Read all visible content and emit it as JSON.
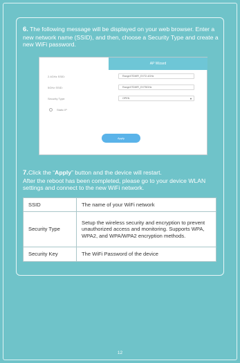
{
  "step6": {
    "number": "6.",
    "text": "The following message will be displayed on your web browser. Enter a new network name (SSID), and then, choose a Security Type and create a new WiFi password."
  },
  "wizard": {
    "title": "AP Wizard",
    "ssid24_label": "2.4GHz SSID:",
    "ssid24_value": "RangeXTDWFi_EXT2.4GHz",
    "ssid5_label": "5GHz SSID:",
    "ssid5_value": "RangeXTDWFi_EXT5GHz",
    "security_label": "Security Type:",
    "security_value": "OPEN",
    "static_ip_label": "Static IP",
    "apply_label": "Apply"
  },
  "step7": {
    "number": "7.",
    "text_before": "Click the “",
    "apply_word": "Apply",
    "text_after": "” button and the device will restart.",
    "line2": "After the reboot has been completed, please go to your device WLAN settings and connect to the new WiFi network."
  },
  "table": {
    "rows": [
      {
        "key": "SSID",
        "value": "The name of your WiFi network"
      },
      {
        "key": "Security Type",
        "value": "Setup the wireless security and encryption to prevent unauthorized access and monitoring. Supports WPA, WPA2, and WPA/WPA2 encryption methods."
      },
      {
        "key": "Security Key",
        "value": "The WiFi Password of the device"
      }
    ]
  },
  "page_number": "12"
}
